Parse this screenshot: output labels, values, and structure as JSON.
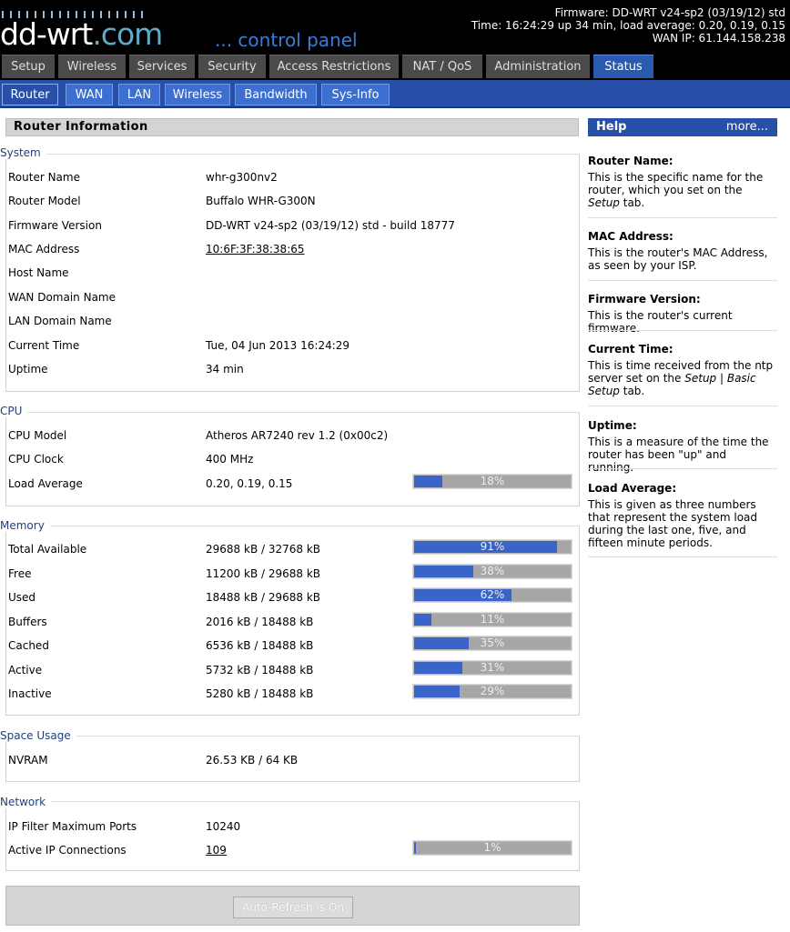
{
  "header": {
    "logo_main": "dd-wrt",
    "logo_suffix": ".com",
    "logo_tagline": "... control panel",
    "firmware_line": "Firmware: DD-WRT v24-sp2 (03/19/12) std",
    "time_line": "Time: 16:24:29 up 34 min, load average: 0.20, 0.19, 0.15",
    "wan_ip_line": "WAN IP: 61.144.158.238"
  },
  "main_tabs": [
    {
      "label": "Setup"
    },
    {
      "label": "Wireless"
    },
    {
      "label": "Services"
    },
    {
      "label": "Security"
    },
    {
      "label": "Access Restrictions"
    },
    {
      "label": "NAT / QoS"
    },
    {
      "label": "Administration"
    },
    {
      "label": "Status",
      "active": true
    }
  ],
  "sub_tabs": [
    {
      "label": "Router",
      "active": true
    },
    {
      "label": "WAN"
    },
    {
      "label": "LAN"
    },
    {
      "label": "Wireless"
    },
    {
      "label": "Bandwidth"
    },
    {
      "label": "Sys-Info"
    }
  ],
  "page_title": "Router Information",
  "system": {
    "legend": "System",
    "rows": [
      {
        "label": "Router Name",
        "value": "whr-g300nv2"
      },
      {
        "label": "Router Model",
        "value": "Buffalo WHR-G300N"
      },
      {
        "label": "Firmware Version",
        "value": "DD-WRT v24-sp2 (03/19/12) std - build 18777"
      },
      {
        "label": "MAC Address",
        "value": "10:6F:3F:38:38:65"
      },
      {
        "label": "Host Name",
        "value": ""
      },
      {
        "label": "WAN Domain Name",
        "value": ""
      },
      {
        "label": "LAN Domain Name",
        "value": ""
      },
      {
        "label": "Current Time",
        "value": "Tue, 04 Jun 2013 16:24:29"
      },
      {
        "label": "Uptime",
        "value": "34 min"
      }
    ]
  },
  "cpu": {
    "legend": "CPU",
    "rows": [
      {
        "label": "CPU Model",
        "value": "Atheros AR7240 rev 1.2 (0x00c2)"
      },
      {
        "label": "CPU Clock",
        "value": "400 MHz"
      },
      {
        "label": "Load Average",
        "value": "0.20, 0.19, 0.15",
        "percent": 18,
        "percent_label": "18%"
      }
    ]
  },
  "memory": {
    "legend": "Memory",
    "rows": [
      {
        "label": "Total Available",
        "value": "29688 kB / 32768 kB",
        "percent": 91,
        "percent_label": "91%"
      },
      {
        "label": "Free",
        "value": "11200 kB / 29688 kB",
        "percent": 38,
        "percent_label": "38%"
      },
      {
        "label": "Used",
        "value": "18488 kB / 29688 kB",
        "percent": 62,
        "percent_label": "62%"
      },
      {
        "label": "Buffers",
        "value": "2016 kB / 18488 kB",
        "percent": 11,
        "percent_label": "11%"
      },
      {
        "label": "Cached",
        "value": "6536 kB / 18488 kB",
        "percent": 35,
        "percent_label": "35%"
      },
      {
        "label": "Active",
        "value": "5732 kB / 18488 kB",
        "percent": 31,
        "percent_label": "31%"
      },
      {
        "label": "Inactive",
        "value": "5280 kB / 18488 kB",
        "percent": 29,
        "percent_label": "29%"
      }
    ]
  },
  "space": {
    "legend": "Space Usage",
    "rows": [
      {
        "label": "NVRAM",
        "value": "26.53 KB / 64 KB"
      }
    ]
  },
  "network": {
    "legend": "Network",
    "rows": [
      {
        "label": "IP Filter Maximum Ports",
        "value": "10240"
      },
      {
        "label": "Active IP Connections",
        "value": "109",
        "percent": 1,
        "percent_label": "1%"
      }
    ]
  },
  "auto_refresh_label": "Auto-Refresh is On",
  "help": {
    "title": "Help",
    "more": "more...",
    "sections": [
      {
        "title": "Router Name:",
        "pre": "This is the specific name for the router, which you set on the ",
        "em": "Setup",
        "post": " tab."
      },
      {
        "title": "MAC Address:",
        "pre": "This is the router's MAC Address, as seen by your ISP.",
        "em": "",
        "post": ""
      },
      {
        "title": "Firmware Version:",
        "pre": "This is the router's current firmware.",
        "em": "",
        "post": ""
      },
      {
        "title": "Current Time:",
        "pre": "This is time received from the ntp server set on the ",
        "em": "Setup | Basic Setup",
        "post": " tab."
      },
      {
        "title": "Uptime:",
        "pre": "This is a measure of the time the router has been \"up\" and running.",
        "em": "",
        "post": ""
      },
      {
        "title": "Load Average:",
        "pre": "This is given as three numbers that represent the system load during the last one, five, and fifteen minute periods.",
        "em": "",
        "post": ""
      }
    ]
  },
  "colors": {
    "header_bg": "#000000",
    "tab_bg": "#4a4a4a",
    "accent_blue": "#2850a8",
    "bar_fill": "#3a64c8",
    "bar_track": "#a6a6a6"
  }
}
